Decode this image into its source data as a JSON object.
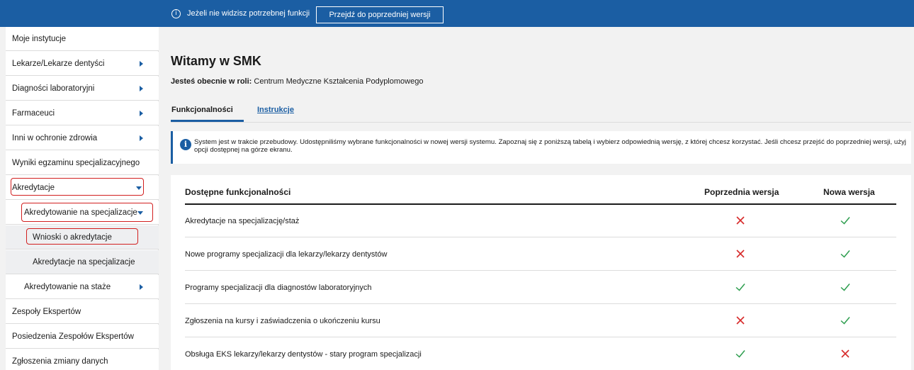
{
  "topbar": {
    "info_icon": "i",
    "message": "Jeżeli nie widzisz potrzebnej funkcji",
    "prev_button": "Przejdź do poprzedniej wersji",
    "color": "#1b5ea3"
  },
  "sidebar": {
    "items": [
      {
        "label": "Moje instytucje"
      },
      {
        "label": "Lekarze/Lekarze dentyści"
      },
      {
        "label": "Diagności laboratoryjni"
      },
      {
        "label": "Farmaceuci"
      },
      {
        "label": "Inni w ochronie zdrowia"
      },
      {
        "label": "Wyniki egzaminu specjalizacyjnego"
      },
      {
        "label": "Akredytacje"
      },
      {
        "label": "Akredytowanie na specjalizacje"
      },
      {
        "label": "Wnioski o akredytacje"
      },
      {
        "label": "Akredytacje na specjalizacje"
      },
      {
        "label": "Akredytowanie na staże"
      },
      {
        "label": "Zespoły Ekspertów"
      },
      {
        "label": "Posiedzenia Zespołów Ekspertów"
      },
      {
        "label": "Zgłoszenia zmiany danych"
      }
    ]
  },
  "main": {
    "title": "Witamy w SMK",
    "role_label": "Jesteś obecnie w roli:",
    "role_value": " Centrum Medyczne Kształcenia Podyplomowego",
    "tabs": [
      {
        "label": "Funkcjonalności"
      },
      {
        "label": "Instrukcje"
      }
    ],
    "alert": {
      "icon": "i",
      "text": "System jest w trakcie przebudowy. Udostępniliśmy wybrane funkcjonalności w nowej wersji systemu. Zapoznaj się z poniższą tabelą i wybierz odpowiednią wersję, z której chcesz korzystać. Jeśli chcesz przejść do poprzedniej wersji, użyj opcji dostępnej na górze ekranu."
    },
    "table": {
      "headers": [
        "Dostępne funkcjonalności",
        "Poprzednia wersja",
        "Nowa wersja"
      ],
      "rows": [
        {
          "name": "Akredytacje na specjalizację/staż",
          "prev": "cross",
          "new": "check"
        },
        {
          "name": "Nowe programy specjalizacji dla lekarzy/lekarzy dentystów",
          "prev": "cross",
          "new": "check"
        },
        {
          "name": "Programy specjalizacji dla diagnostów laboratoryjnych",
          "prev": "check",
          "new": "check"
        },
        {
          "name": "Zgłoszenia na kursy i zaświadczenia o ukończeniu kursu",
          "prev": "cross",
          "new": "check"
        },
        {
          "name": "Obsługa EKS lekarzy/lekarzy dentystów - stary program specjalizacji",
          "prev": "check",
          "new": "cross"
        }
      ]
    }
  },
  "colors": {
    "check": "#2e9e4f",
    "cross": "#d72b2b",
    "accent": "#1b5ea3",
    "highlight": "#d21f1f"
  }
}
